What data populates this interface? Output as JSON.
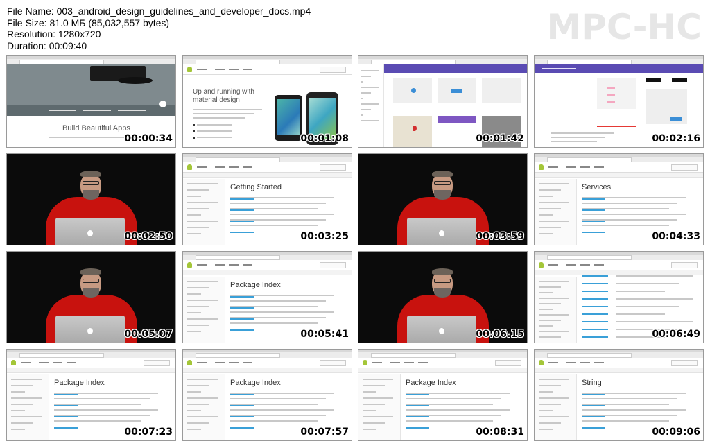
{
  "header": {
    "file_name": "File Name: 003_android_design_guidelines_and_developer_docs.mp4",
    "file_size": "File Size: 81.0 МБ (85,032,557 bytes)",
    "resolution": "Resolution: 1280x720",
    "duration": "Duration: 00:09:40"
  },
  "logo": "MPC-HC",
  "thumbs": [
    {
      "time": "00:00:34",
      "kind": "site-hero",
      "text": "Build Beautiful Apps"
    },
    {
      "time": "00:01:08",
      "kind": "material",
      "text": "Up and running with material design"
    },
    {
      "time": "00:01:42",
      "kind": "design-grid"
    },
    {
      "time": "00:02:16",
      "kind": "design-spec"
    },
    {
      "time": "00:02:50",
      "kind": "presenter"
    },
    {
      "time": "00:03:25",
      "kind": "docs",
      "text": "Getting Started"
    },
    {
      "time": "00:03:59",
      "kind": "presenter"
    },
    {
      "time": "00:04:33",
      "kind": "docs",
      "text": "Services"
    },
    {
      "time": "00:05:07",
      "kind": "presenter"
    },
    {
      "time": "00:05:41",
      "kind": "docs",
      "text": "Package Index"
    },
    {
      "time": "00:06:15",
      "kind": "presenter"
    },
    {
      "time": "00:06:49",
      "kind": "reference"
    },
    {
      "time": "00:07:23",
      "kind": "docs",
      "text": "Package Index"
    },
    {
      "time": "00:07:57",
      "kind": "docs",
      "text": "Package Index"
    },
    {
      "time": "00:08:31",
      "kind": "docs",
      "text": "Package Index"
    },
    {
      "time": "00:09:06",
      "kind": "docs",
      "text": "String"
    }
  ],
  "colors": {
    "shirt": "#c8120e",
    "android_green": "#a4c639",
    "material_purple": "#5a4bb3",
    "link_blue": "#3aa0d8"
  }
}
